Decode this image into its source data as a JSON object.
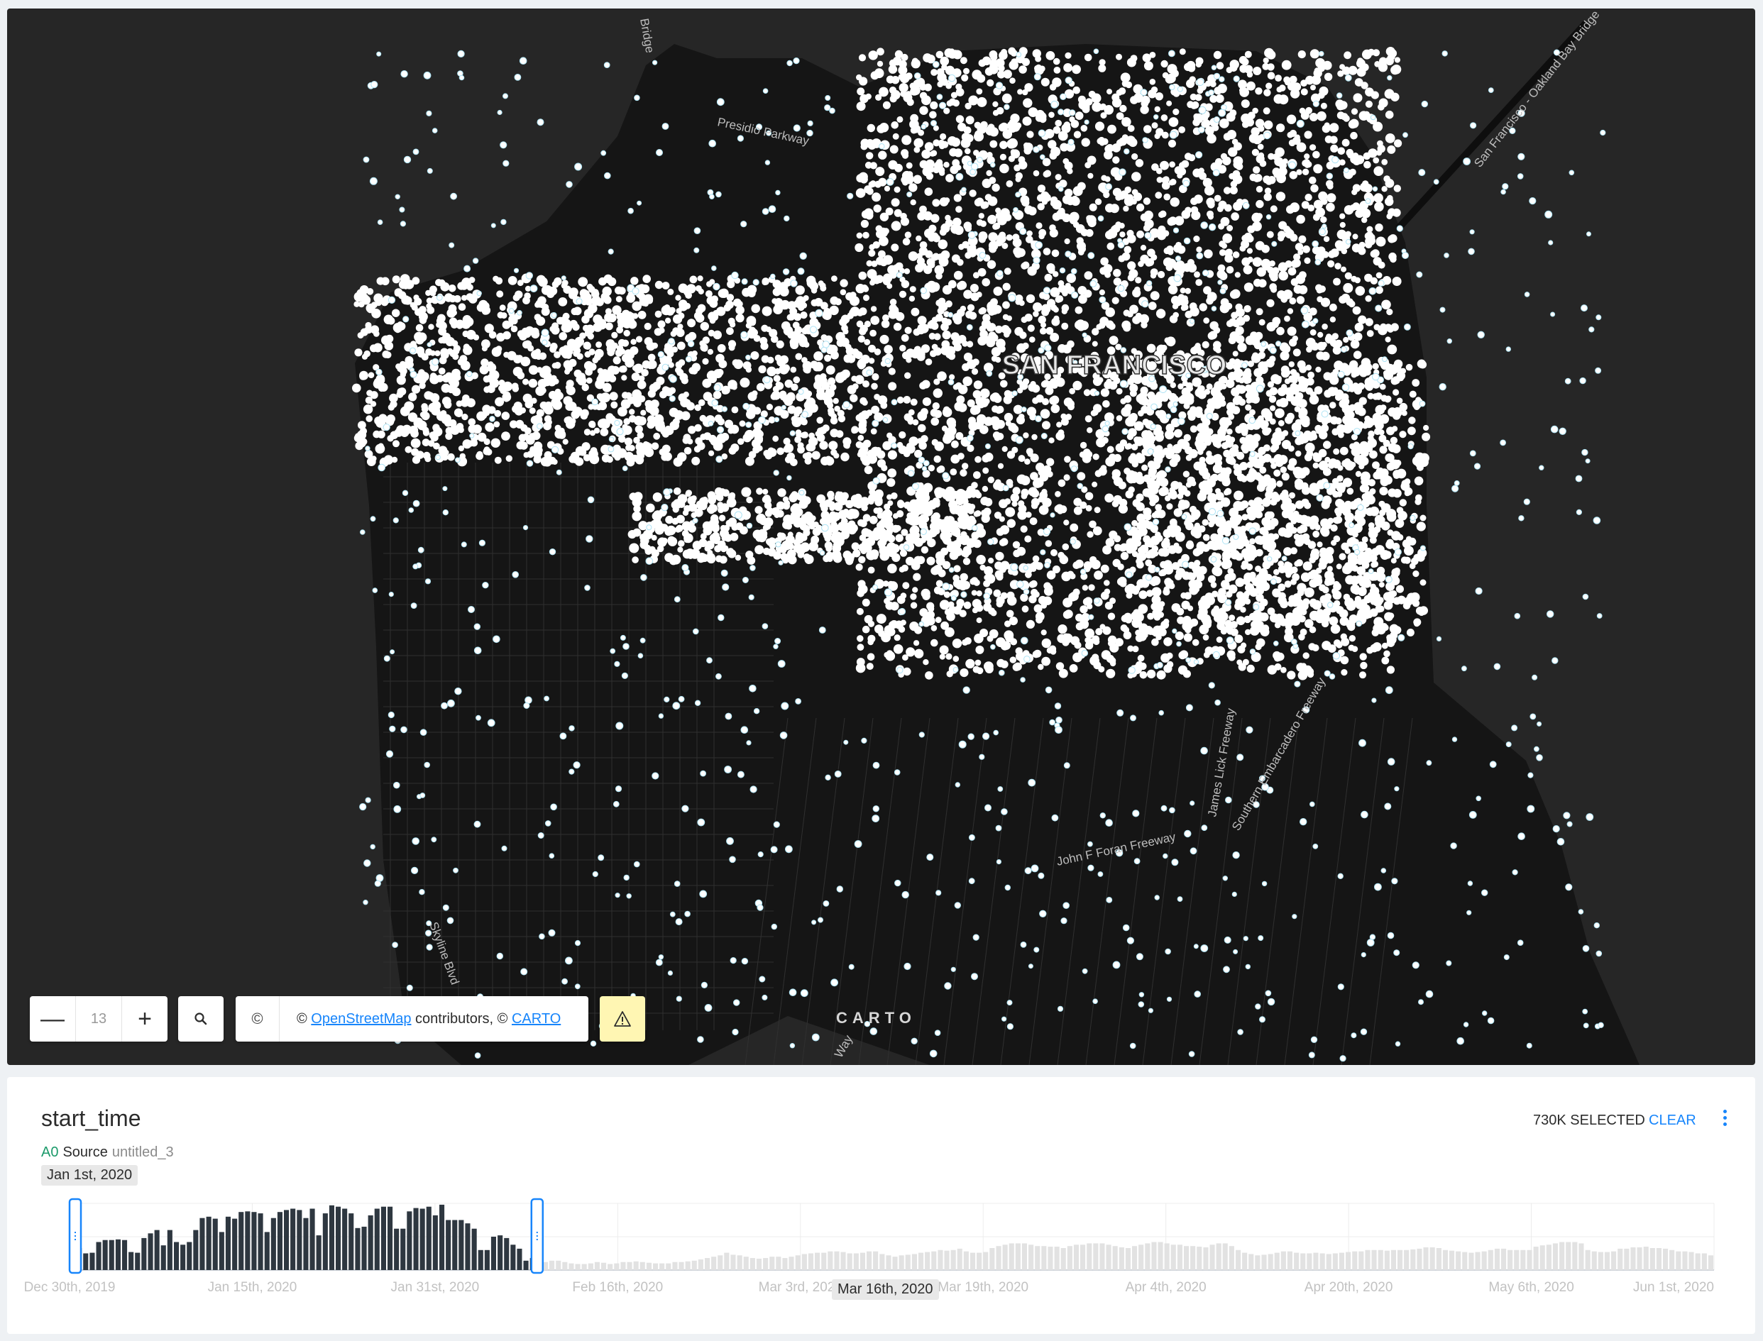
{
  "map": {
    "city_label": "SAN FRANCISCO",
    "roads": [
      "Presidio Parkway",
      "San Francisco - Oakland Bay Bridge",
      "James Lick Freeway",
      "John F Foran Freeway",
      "Southern Embarcadero Freeway",
      "Skyline Blvd",
      "Bridge",
      "Way"
    ],
    "zoom_level": "13",
    "zoom_out_icon": "minus-icon",
    "zoom_in_icon": "plus-icon",
    "search_icon": "search-icon",
    "attribution": {
      "copyright_symbol": "©",
      "prefix": "© ",
      "osm_link": "OpenStreetMap",
      "middle": " contributors, © ",
      "carto_link": "CARTO"
    },
    "warning_icon": "warning-icon",
    "logo": "CARTO",
    "colors": {
      "background": "#262626",
      "points": "#ffffff",
      "point_halo": "#aee4f5",
      "warning": "#fff6b3"
    }
  },
  "widget": {
    "title": "start_time",
    "selected_text": "730K SELECTED",
    "clear_label": "CLEAR",
    "menu_icon": "more-vertical-icon",
    "source_id": "A0",
    "source_label": "Source",
    "source_name": "untitled_3",
    "range_start": "Jan 1st, 2020",
    "range_end": "Mar 16th, 2020",
    "colors": {
      "selected_bar": "#2e3740",
      "unselected_bar": "#e2e2e2",
      "handle": "#1785fb",
      "accent": "#1785fb",
      "source_id": "#1b9a6a"
    }
  },
  "chart_data": {
    "type": "bar",
    "title": "start_time",
    "xlabel": "",
    "ylabel": "",
    "x_tick_labels": [
      "Dec 30th, 2019",
      "Jan 15th, 2020",
      "Jan 31st, 2020",
      "Feb 16th, 2020",
      "Mar 3rd, 2020",
      "Mar 19th, 2020",
      "Apr 4th, 2020",
      "Apr 20th, 2020",
      "May 6th, 2020",
      "Jun 1st, 2020"
    ],
    "ylim": [
      0,
      100
    ],
    "grid": true,
    "selected_range": [
      "Jan 1st, 2020",
      "Mar 16th, 2020"
    ],
    "selected_values": [
      30,
      33,
      25,
      26,
      42,
      45,
      45,
      46,
      45,
      27,
      26,
      48,
      55,
      60,
      37,
      60,
      42,
      38,
      42,
      60,
      78,
      80,
      77,
      57,
      80,
      77,
      87,
      88,
      87,
      85,
      57,
      78,
      87,
      90,
      92,
      90,
      78,
      92,
      52,
      85,
      97,
      95,
      92,
      85,
      63,
      65,
      82,
      92,
      95,
      95,
      62,
      62,
      88,
      93,
      92,
      95,
      82,
      98,
      75,
      75,
      75,
      70,
      62,
      30,
      30,
      50,
      52,
      48,
      38,
      32,
      14,
      18
    ],
    "unselected_values": [
      10,
      12,
      14,
      14,
      12,
      10,
      9,
      9,
      10,
      12,
      11,
      9,
      10,
      12,
      12,
      13,
      12,
      11,
      10,
      10,
      10,
      12,
      12,
      13,
      14,
      16,
      18,
      20,
      22,
      26,
      23,
      22,
      20,
      18,
      17,
      18,
      20,
      20,
      18,
      20,
      22,
      24,
      25,
      26,
      26,
      28,
      28,
      27,
      25,
      25,
      26,
      28,
      28,
      24,
      22,
      20,
      22,
      23,
      24,
      26,
      27,
      28,
      30,
      29,
      30,
      32,
      28,
      26,
      26,
      27,
      33,
      36,
      38,
      40,
      40,
      40,
      38,
      36,
      36,
      35,
      35,
      33,
      36,
      38,
      38,
      40,
      40,
      40,
      38,
      36,
      34,
      33,
      36,
      38,
      40,
      42,
      42,
      40,
      38,
      38,
      36,
      36,
      35,
      34,
      38,
      40,
      40,
      36,
      30,
      26,
      24,
      22,
      23,
      24,
      26,
      28,
      28,
      26,
      25,
      25,
      26,
      25,
      24,
      25,
      26,
      27,
      28,
      28,
      30,
      30,
      30,
      29,
      30,
      30,
      30,
      31,
      32,
      34,
      34,
      33,
      30,
      29,
      28,
      27,
      26,
      27,
      28,
      30,
      32,
      32,
      30,
      30,
      30,
      30,
      35,
      37,
      38,
      40,
      42,
      42,
      42,
      40,
      30,
      28,
      27,
      27,
      28,
      32,
      32,
      34,
      34,
      35,
      33,
      33,
      32,
      30,
      28,
      28,
      27,
      25,
      25,
      22
    ]
  }
}
